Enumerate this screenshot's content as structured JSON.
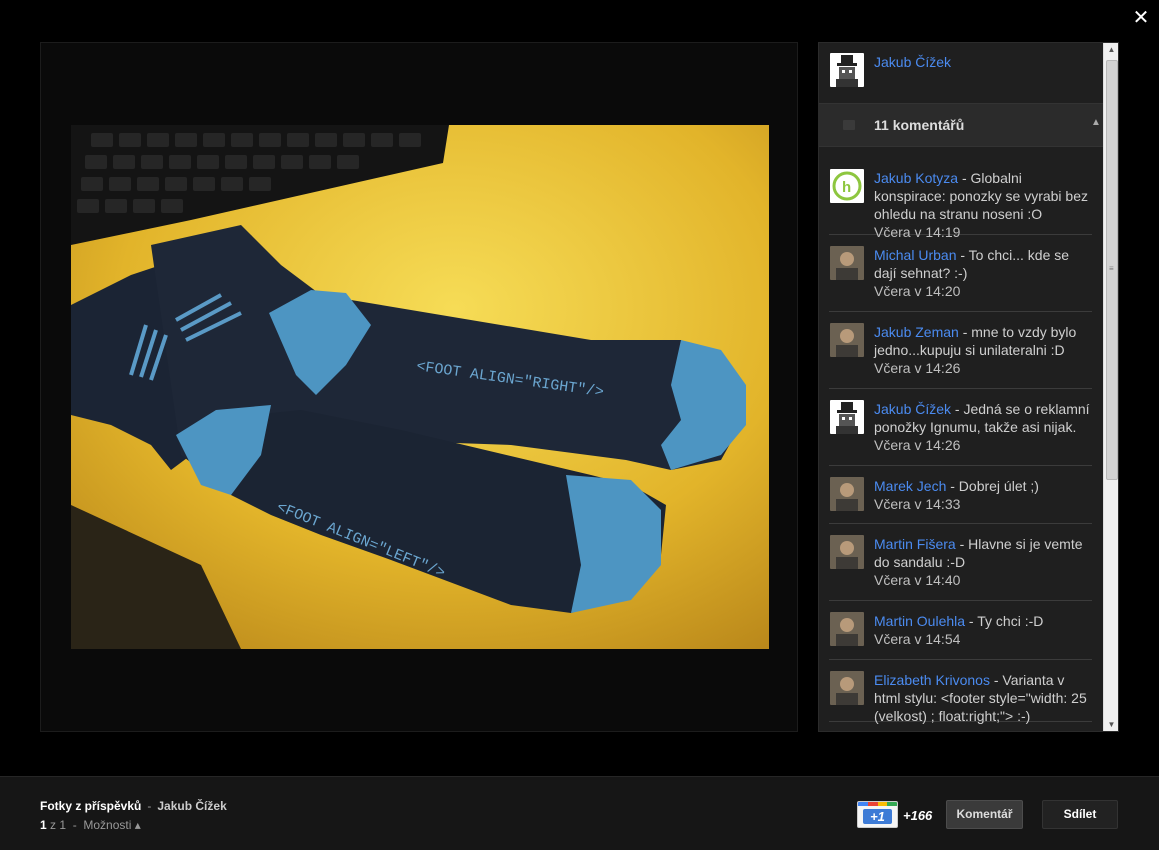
{
  "viewer": {
    "close_label": "✕",
    "expand_label": "⤡"
  },
  "sidebar": {
    "owner_name": "Jakub Čížek",
    "comments_count_label": "11 komentářů",
    "comments": [
      {
        "author": "Jakub Kotyza",
        "text": " - Globalni konspirace: ponozky se vyrabi bez ohledu na stranu noseni :O",
        "time": "Včera v 14:19",
        "avatar": "h-logo"
      },
      {
        "author": "Michal Urban",
        "text": " - To chci... kde se dají sehnat? :-)",
        "time": "Včera v 14:20",
        "avatar": "photo"
      },
      {
        "author": "Jakub Zeman",
        "text": " - mne to vzdy bylo jedno...kupuju si unilateralni :D",
        "time": "Včera v 14:26",
        "avatar": "photo"
      },
      {
        "author": "Jakub Čížek",
        "text": " - Jedná se o reklamní ponožky Ignumu, takže asi nijak.",
        "time": "Včera v 14:26",
        "avatar": "robot"
      },
      {
        "author": "Marek Jech",
        "text": " - Dobrej úlet ;)",
        "time": "Včera v 14:33",
        "avatar": "photo"
      },
      {
        "author": "Martin Fišera",
        "text": " - Hlavne si je vemte do sandalu :-D",
        "time": "Včera v 14:40",
        "avatar": "photo"
      },
      {
        "author": "Martin Oulehla",
        "text": " - Ty chci :-D",
        "time": "Včera v 14:54",
        "avatar": "photo"
      },
      {
        "author": "Elizabeth Krivonos",
        "text": " - Varianta v html stylu: <footer style=\"width: 25 (velkost) ; float:right;\"> :-)",
        "time": "",
        "avatar": "photo"
      }
    ]
  },
  "footer": {
    "album_title": "Fotky z příspěvků",
    "separator": "-",
    "album_owner": "Jakub Čížek",
    "pager_current": "1",
    "pager_rest": " z 1  -  ",
    "options_label": "Možnosti ▴",
    "plus_one_label": "+1",
    "plus_one_count": "+166",
    "comment_button": "Komentář",
    "share_button": "Sdílet"
  },
  "colors": {
    "link": "#4b8bf0",
    "background": "#000000",
    "sidebar": "#1f1f1f"
  }
}
